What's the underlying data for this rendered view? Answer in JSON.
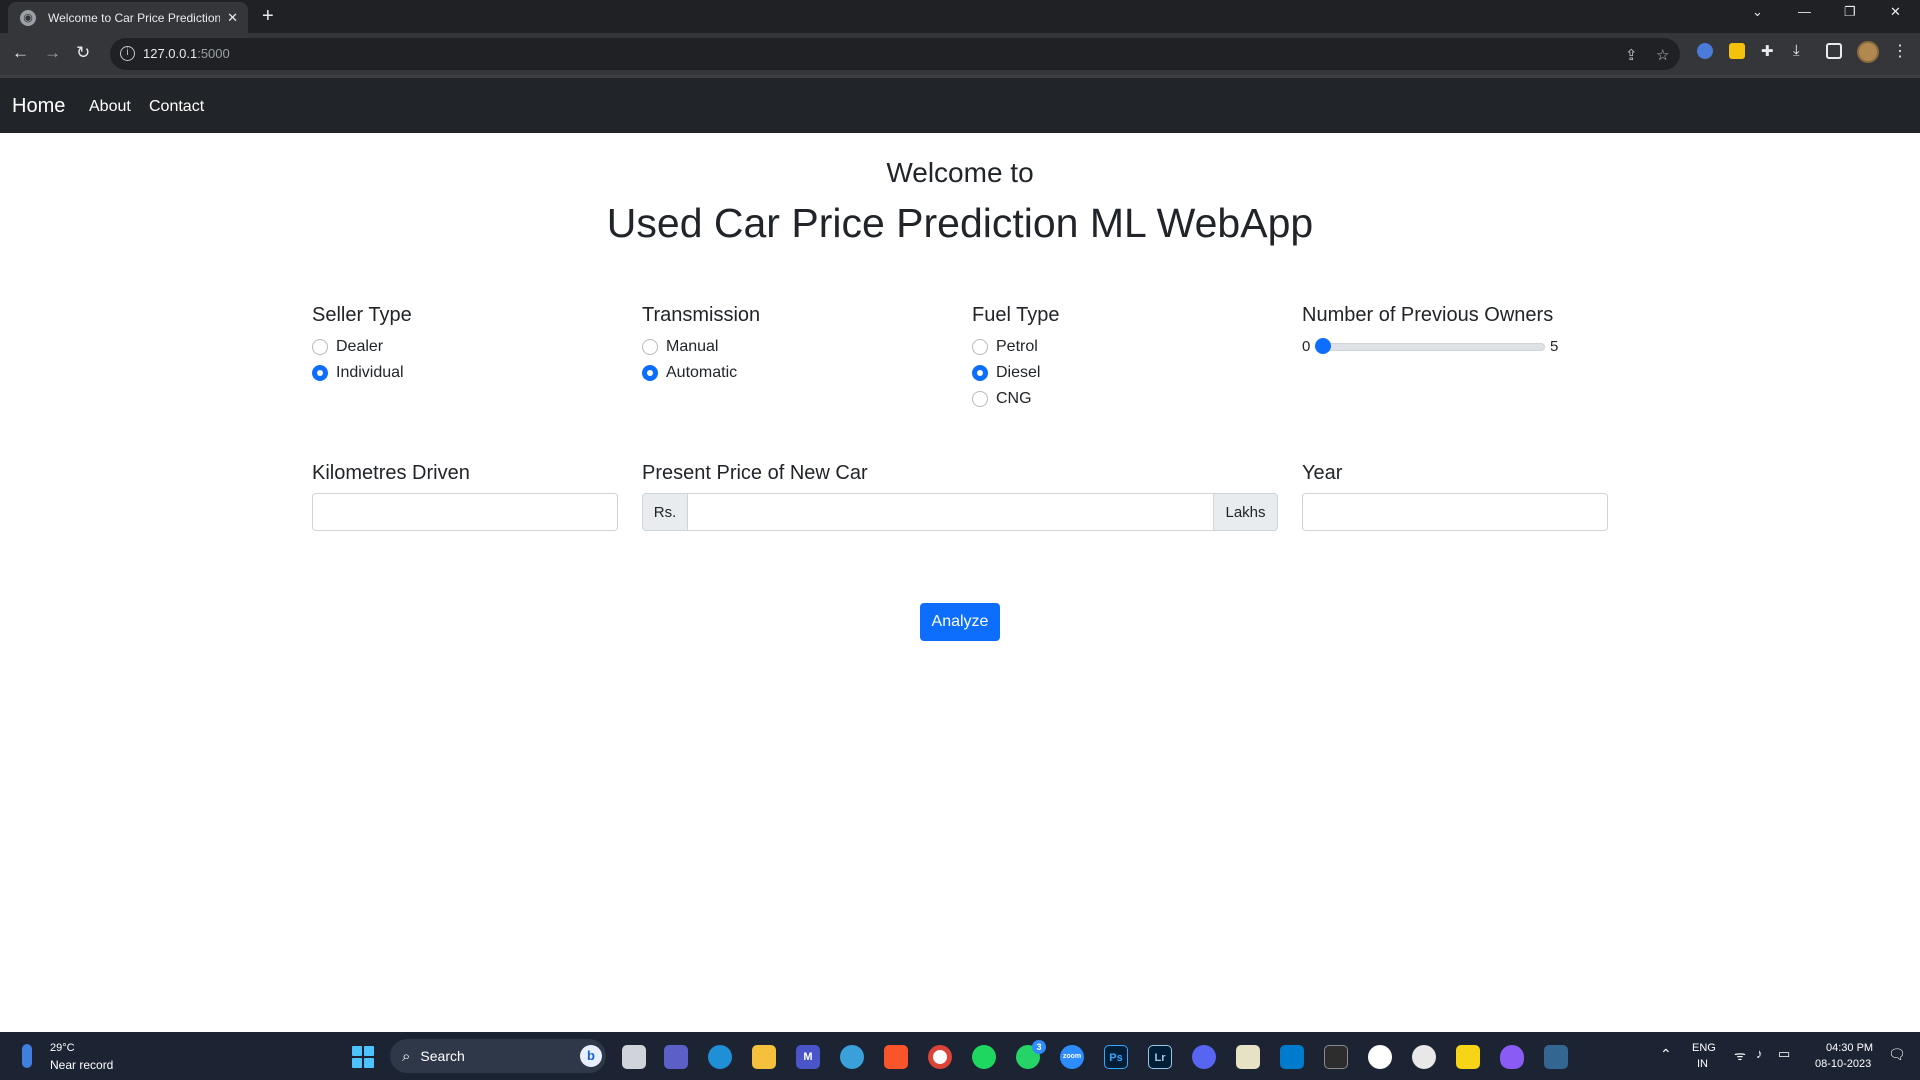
{
  "browser": {
    "tab_title": "Welcome to Car Price Prediction",
    "url_host": "127.0.0.1",
    "url_port": ":5000"
  },
  "navbar": {
    "brand": "Home",
    "links": [
      "About",
      "Contact"
    ]
  },
  "header": {
    "welcome": "Welcome to",
    "title": "Used Car Price Prediction ML WebApp"
  },
  "form": {
    "seller_type": {
      "label": "Seller Type",
      "options": [
        "Dealer",
        "Individual"
      ],
      "selected": "Individual"
    },
    "transmission": {
      "label": "Transmission",
      "options": [
        "Manual",
        "Automatic"
      ],
      "selected": "Automatic"
    },
    "fuel_type": {
      "label": "Fuel Type",
      "options": [
        "Petrol",
        "Diesel",
        "CNG"
      ],
      "selected": "Diesel"
    },
    "owners": {
      "label": "Number of Previous Owners",
      "min": "0",
      "max": "5",
      "value": 0
    },
    "kms": {
      "label": "Kilometres Driven",
      "value": ""
    },
    "price": {
      "label": "Present Price of New Car",
      "prefix": "Rs.",
      "suffix": "Lakhs",
      "value": ""
    },
    "year": {
      "label": "Year",
      "value": ""
    },
    "submit_label": "Analyze"
  },
  "taskbar": {
    "weather_temp": "29°C",
    "weather_desc": "Near record",
    "search_label": "Search",
    "lang_1": "ENG",
    "lang_2": "IN",
    "time": "04:30 PM",
    "date": "08-10-2023",
    "notification_badge": "3"
  },
  "colors": {
    "accent": "#0d6efd",
    "navbar_bg": "#212529",
    "chrome_bg": "#202124",
    "taskbar_bg": "#1c2433"
  }
}
